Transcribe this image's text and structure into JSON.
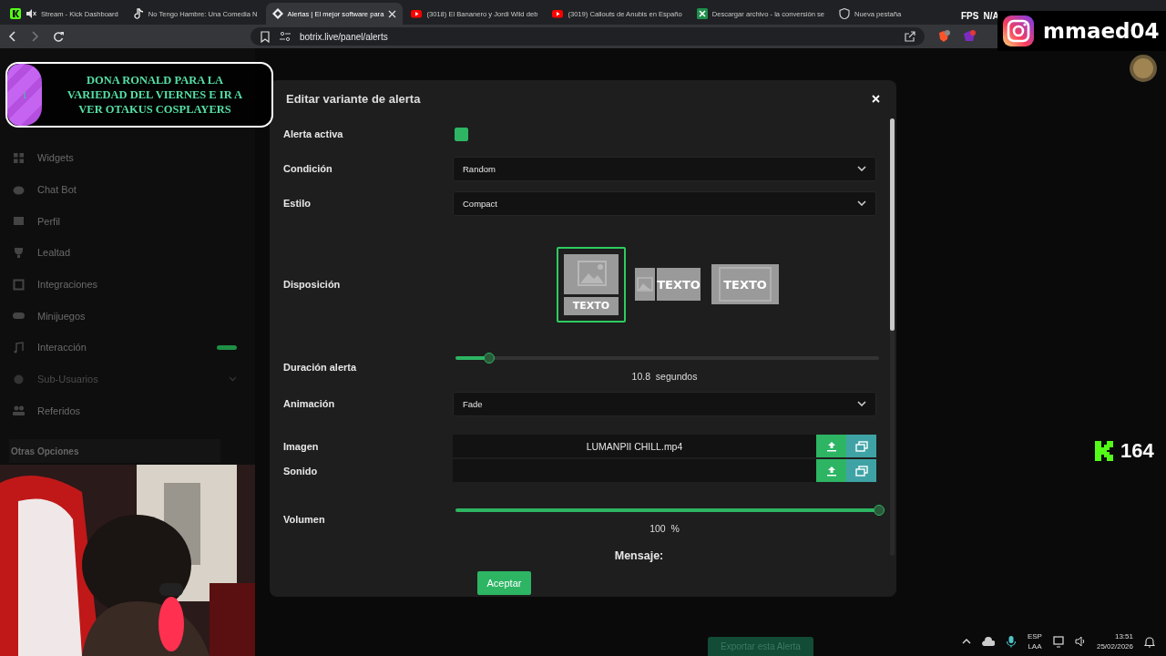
{
  "browser": {
    "tabs": [
      {
        "title": "Stream - Kick Dashboard",
        "kind": "kick",
        "selected": false,
        "muted": true
      },
      {
        "title": "No Tengo Hambre: Una Comedia N",
        "kind": "note",
        "selected": false,
        "muted": false
      },
      {
        "title": "Alertas | El mejor software para",
        "kind": "diamond",
        "selected": true,
        "muted": false
      },
      {
        "title": "(3018) El Bananero y Jordi Wild deb",
        "kind": "video",
        "selected": false,
        "muted": false
      },
      {
        "title": "(3019) Callouts de Anubis en Españo",
        "kind": "video",
        "selected": false,
        "muted": false
      },
      {
        "title": "Descargar archivo - la conversión se",
        "kind": "sheet",
        "selected": false,
        "muted": false
      },
      {
        "title": "Nueva pestaña",
        "kind": "shield",
        "selected": false,
        "muted": false
      }
    ],
    "url": "botrix.live/panel/alerts"
  },
  "sidebar": {
    "items": [
      {
        "label": "Widgets",
        "badge": false,
        "disabled": false,
        "expandable": false
      },
      {
        "label": "Chat Bot",
        "badge": false,
        "disabled": false,
        "expandable": false
      },
      {
        "label": "Perfil",
        "badge": false,
        "disabled": false,
        "expandable": false
      },
      {
        "label": "Lealtad",
        "badge": false,
        "disabled": false,
        "expandable": false
      },
      {
        "label": "Integraciones",
        "badge": false,
        "disabled": false,
        "expandable": false
      },
      {
        "label": "Minijuegos",
        "badge": false,
        "disabled": false,
        "expandable": false
      },
      {
        "label": "Interacción",
        "badge": true,
        "disabled": false,
        "expandable": false
      },
      {
        "label": "Sub-Usuarios",
        "badge": false,
        "disabled": true,
        "expandable": true
      },
      {
        "label": "Referidos",
        "badge": false,
        "disabled": false,
        "expandable": false
      }
    ],
    "section": "Otras Opciones"
  },
  "modal": {
    "title": "Editar variante de alerta",
    "rows": [
      {
        "kind": "checkbox",
        "label": "Alerta activa",
        "checked": true
      },
      {
        "kind": "select",
        "label": "Condición",
        "value": "Random"
      },
      {
        "kind": "select",
        "label": "Estilo",
        "value": "Compact"
      },
      {
        "kind": "layout",
        "label": "Disposición",
        "options": [
          {
            "kind": "stacked",
            "text": "TEXTO",
            "selected": true
          },
          {
            "kind": "side",
            "text": "TEXTO",
            "selected": false
          },
          {
            "kind": "overlay",
            "text": "TEXTO",
            "selected": false
          }
        ]
      },
      {
        "kind": "slider",
        "label": "Duración alerta",
        "level": 0.08,
        "reading": "10.8  segundos"
      },
      {
        "kind": "select",
        "label": "Animación",
        "value": "Fade"
      },
      {
        "kind": "file",
        "label": "Imagen",
        "value": "LUMANPII CHILL.mp4"
      },
      {
        "kind": "file",
        "label": "Sonido"
      },
      {
        "kind": "slider",
        "label": "Volumen",
        "level": 1,
        "reading": "100  %"
      }
    ],
    "message_label": "Mensaje:",
    "accept_button": "Aceptar"
  },
  "export_button": "Exportar esta Alerta",
  "overlays": {
    "donation": {
      "badge": "1",
      "lines": [
        "DONA RONALD PARA LA",
        "VARIEDAD DEL VIERNES E IR A",
        "VER OTAKUS COSPLAYERS"
      ]
    },
    "fps": {
      "label": "FPS",
      "value": "N/A"
    },
    "instagram": {
      "handle": "mmaed04"
    },
    "kick_counter": {
      "count": "164"
    }
  },
  "taskbar": {
    "language": "ESP",
    "layout": "LAA",
    "time": "13:51",
    "date": "25/02/2026"
  }
}
